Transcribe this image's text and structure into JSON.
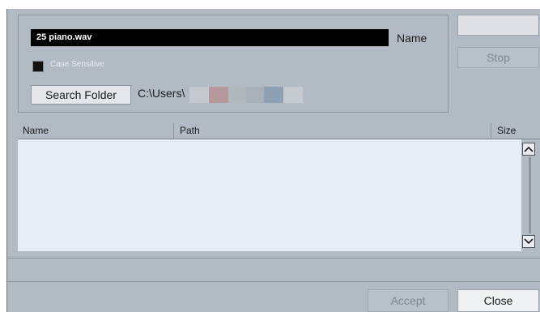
{
  "search": {
    "name_value": "25 piano.wav",
    "name_label": "Name",
    "case_sensitive_label": "Case Sensitive",
    "case_sensitive_checked": false,
    "search_folder_button": "Search Folder",
    "folder_path": "C:\\Users\\"
  },
  "actions": {
    "top_button_label": "",
    "stop_label": "Stop",
    "accept_label": "Accept",
    "close_label": "Close"
  },
  "results": {
    "columns": [
      "Name",
      "Path",
      "Size"
    ],
    "rows": []
  },
  "icons": {
    "scroll_up": "chevron-up-icon",
    "scroll_down": "chevron-down-icon"
  },
  "colors": {
    "panel": "#b2bac3",
    "input_bg": "#000000",
    "results_bg": "#e5ecf4",
    "disabled_text": "#808890"
  }
}
